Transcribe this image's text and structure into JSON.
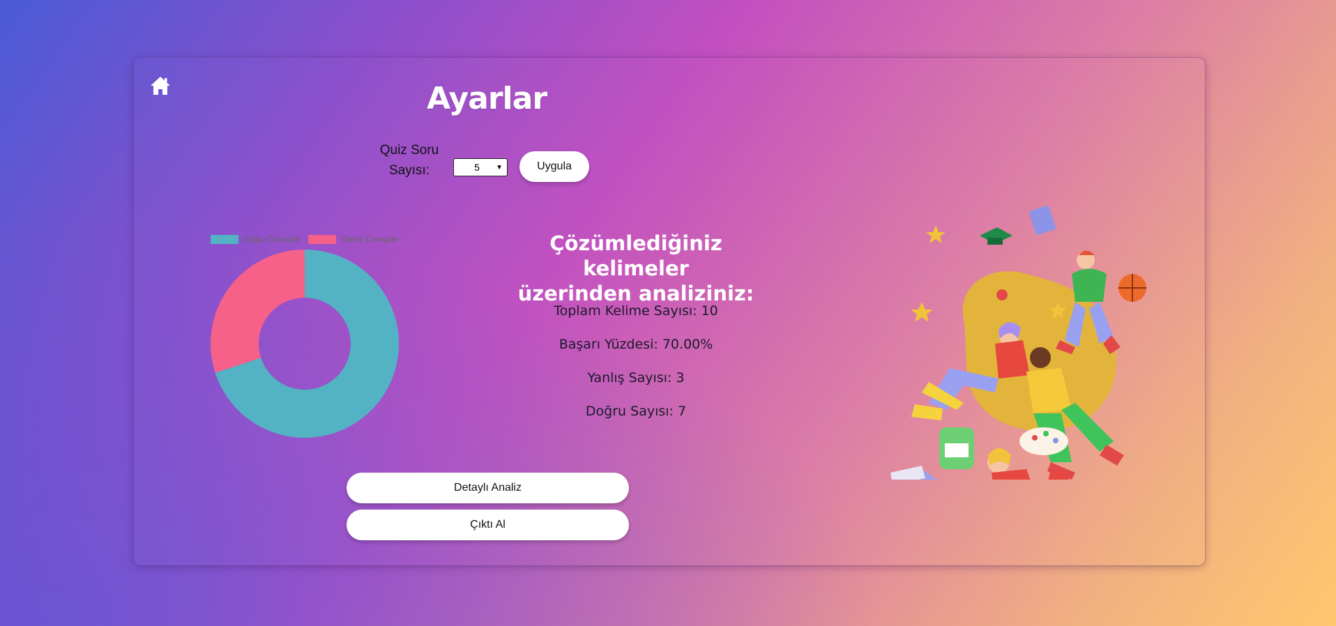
{
  "page": {
    "title": "Ayarlar"
  },
  "icons": {
    "home": "home-icon"
  },
  "settings": {
    "quiz_label_line1": "Quiz Soru",
    "quiz_label_line2": "Sayısı:",
    "quiz_count_selected": "5",
    "apply_label": "Uygula"
  },
  "chart_data": {
    "type": "pie",
    "categories": [
      "Doğru Cevaplar",
      "Yanlış Cevaplar"
    ],
    "values": [
      7,
      3
    ],
    "colors": [
      "#53b3c4",
      "#f56189"
    ],
    "legend": "top",
    "donut": true
  },
  "analysis": {
    "title_line1": "Çözümlediğiniz kelimeler",
    "title_line2": "üzerinden analiziniz:",
    "total": "Toplam Kelime Sayısı: 10",
    "success": "Başarı Yüzdesi: 70.00%",
    "wrong": "Yanlış Sayısı: 3",
    "correct": "Doğru Sayısı: 7"
  },
  "actions": {
    "detail_label": "Detaylı Analiz",
    "export_label": "Çıktı Al"
  },
  "colors": {
    "card_border": "#9b4da8",
    "button_bg": "#ffffff",
    "blob": "#e2b43b"
  }
}
